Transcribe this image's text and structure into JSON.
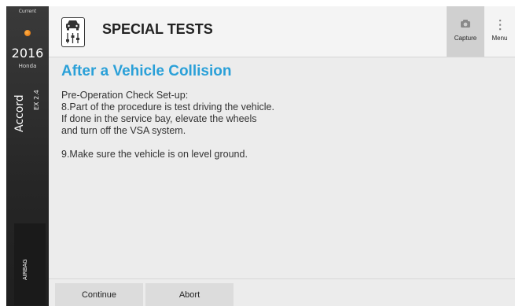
{
  "sidebar": {
    "current_label": "Current",
    "year": "2016",
    "make": "Honda",
    "model": "Accord",
    "trim": "EX 2.4",
    "system": "AIRBAG"
  },
  "header": {
    "title": "SPECIAL TESTS",
    "capture_label": "Capture",
    "menu_label": "Menu"
  },
  "content": {
    "heading": "After a Vehicle Collision",
    "lines": [
      "Pre-Operation Check Set-up:",
      "8.Part of the procedure is test driving the vehicle.",
      "If done in the service bay, elevate the wheels",
      "and turn off the VSA system.",
      "",
      "9.Make sure the vehicle is on level ground."
    ]
  },
  "footer": {
    "continue_label": "Continue",
    "abort_label": "Abort"
  },
  "colors": {
    "heading": "#2aa0d8",
    "status_dot": "#f08a1c",
    "sidebar_bg": "#2b2b2b"
  },
  "icons": {
    "header_icon": "car-settings-icon",
    "capture_icon": "camera-icon",
    "menu_icon": "vertical-dots-icon"
  }
}
